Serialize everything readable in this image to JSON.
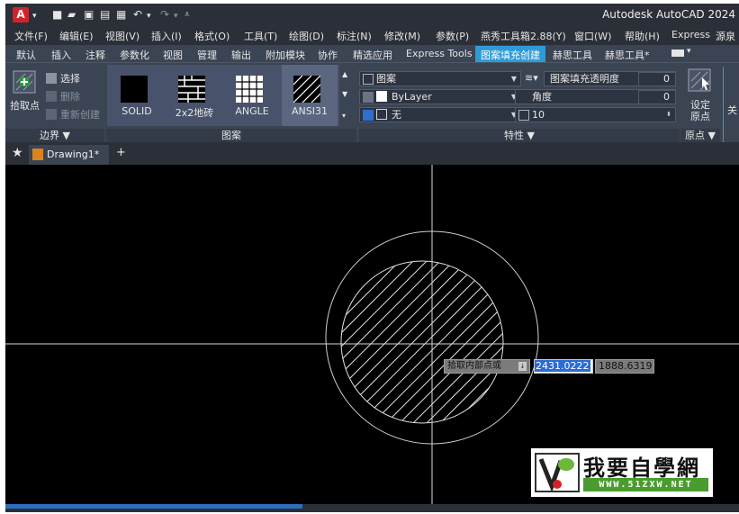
{
  "titlebar": {
    "logo_letter": "A",
    "app_title": "Autodesk AutoCAD 2024"
  },
  "menu": [
    "文件(F)",
    "编辑(E)",
    "视图(V)",
    "插入(I)",
    "格式(O)",
    "工具(T)",
    "绘图(D)",
    "标注(N)",
    "修改(M)",
    "参数(P)",
    "燕秀工具箱2.88(Y)",
    "窗口(W)",
    "帮助(H)",
    "Express",
    "源泉"
  ],
  "ribbon_tabs": [
    "默认",
    "插入",
    "注释",
    "参数化",
    "视图",
    "管理",
    "输出",
    "附加模块",
    "协作",
    "精选应用",
    "Express Tools",
    "图案填充创建",
    "赫思工具",
    "赫思工具*"
  ],
  "active_tab": "图案填充创建",
  "boundary": {
    "pick_point": "拾取点",
    "select": "选择",
    "remove": "删除",
    "recreate": "重新创建",
    "title": "边界 ▼"
  },
  "pattern": {
    "swatches": [
      "SOLID",
      "2x2地砖",
      "ANGLE",
      "ANSI31"
    ],
    "title": "图案"
  },
  "properties": {
    "type": "图案",
    "transparency_label": "图案填充透明度",
    "transparency_value": "0",
    "color": "ByLayer",
    "angle_label": "角度",
    "angle_value": "0",
    "background": "无",
    "scale_value": "10",
    "title": "特性 ▼"
  },
  "origin": {
    "set_origin": "设定原点",
    "title": "原点 ▼",
    "close_partial": "关"
  },
  "file_tab": {
    "name": "Drawing1*",
    "new_tab": "+"
  },
  "dynamic_input": {
    "prompt": "拾取内部点或",
    "x_value": "2431.0222",
    "y_value": "1888.6319"
  },
  "watermark": {
    "text": "我要自學網",
    "url": "WWW.51ZXW.NET"
  },
  "colors": {
    "accent_tab": "#2e9bd6",
    "canvas": "#000000",
    "ribbon": "#3b4453",
    "logo": "#d2232a"
  }
}
